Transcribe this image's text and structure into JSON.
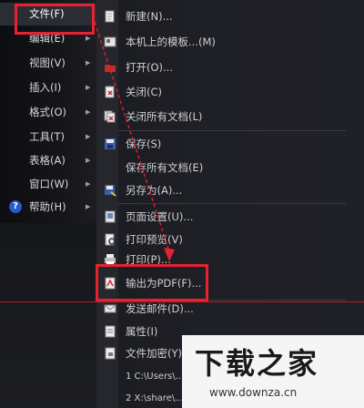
{
  "main_menu": {
    "items": [
      {
        "label": "文件(F)",
        "has_arrow": false
      },
      {
        "label": "编辑(E)",
        "has_arrow": true
      },
      {
        "label": "视图(V)",
        "has_arrow": true
      },
      {
        "label": "插入(I)",
        "has_arrow": true
      },
      {
        "label": "格式(O)",
        "has_arrow": true
      },
      {
        "label": "工具(T)",
        "has_arrow": true
      },
      {
        "label": "表格(A)",
        "has_arrow": true
      },
      {
        "label": "窗口(W)",
        "has_arrow": true
      },
      {
        "label": "帮助(H)",
        "has_arrow": true
      }
    ],
    "arrow_glyph": "▶"
  },
  "file_submenu": {
    "items": [
      {
        "label": "新建(N)...",
        "icon": "new-document-icon"
      },
      {
        "label": "本机上的模板...(M)",
        "icon": "template-icon"
      },
      {
        "label": "打开(O)...",
        "icon": "open-folder-icon"
      },
      {
        "label": "关闭(C)",
        "icon": "close-document-icon"
      },
      {
        "label": "关闭所有文档(L)",
        "icon": "close-all-icon"
      },
      {
        "label": "保存(S)",
        "icon": "save-icon"
      },
      {
        "label": "保存所有文档(E)",
        "icon": ""
      },
      {
        "label": "另存为(A)...",
        "icon": "save-as-icon"
      },
      {
        "label": "页面设置(U)...",
        "icon": "page-setup-icon"
      },
      {
        "label": "打印预览(V)",
        "icon": "print-preview-icon"
      },
      {
        "label": "打印(P)...",
        "icon": "print-icon"
      },
      {
        "label": "输出为PDF(F)...",
        "icon": "pdf-export-icon"
      },
      {
        "label": "发送邮件(D)...",
        "icon": "mail-icon"
      },
      {
        "label": "属性(I)",
        "icon": "properties-icon"
      },
      {
        "label": "文件加密(Y)...",
        "icon": "encrypt-icon"
      },
      {
        "label": "1 C:\\Users\\...",
        "icon": ""
      },
      {
        "label": "2 X:\\share\\...",
        "icon": ""
      }
    ]
  },
  "watermark": {
    "title": "下载之家",
    "url": "www.downza.cn"
  },
  "colors": {
    "annotation_red": "#e52230",
    "menu_background": "#1b1c21"
  }
}
